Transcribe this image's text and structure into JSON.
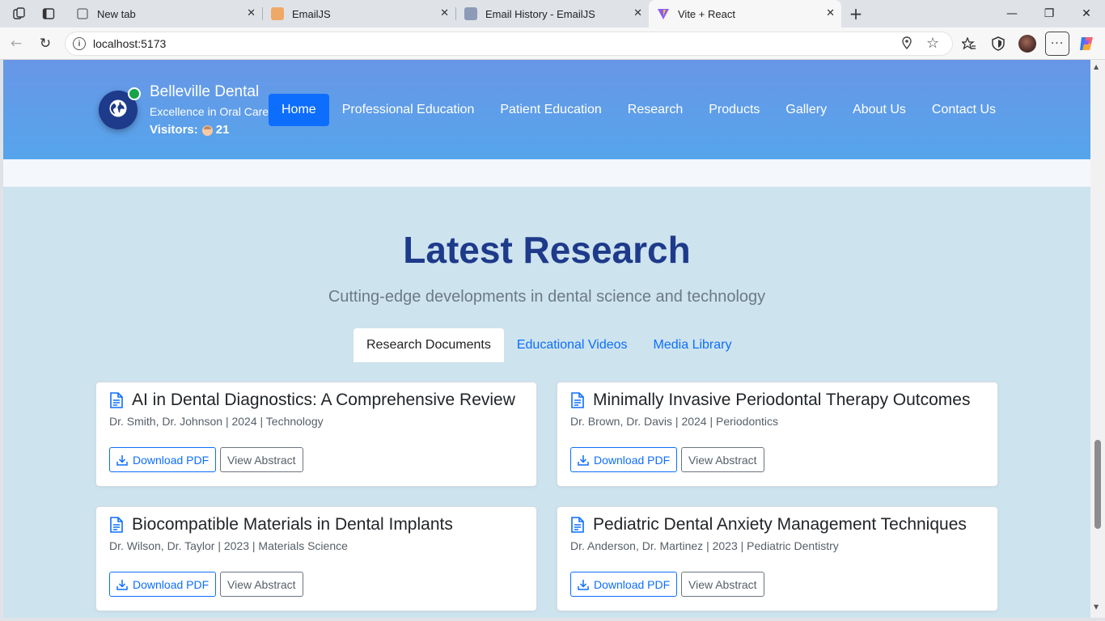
{
  "browser": {
    "tabs": [
      {
        "title": "New tab",
        "icon": "new-tab-icon"
      },
      {
        "title": "EmailJS",
        "icon": "emailjs-icon"
      },
      {
        "title": "Email History - EmailJS",
        "icon": "emailjs-icon"
      },
      {
        "title": "Vite + React",
        "icon": "vite-icon",
        "active": true
      }
    ],
    "url": "localhost:5173"
  },
  "header": {
    "brand_name": "Belleville Dental",
    "tagline": "Excellence in Oral Care",
    "visitors_label": "Visitors:",
    "visitors_count": "21",
    "nav": [
      "Home",
      "Professional Education",
      "Patient Education",
      "Research",
      "Products",
      "Gallery",
      "About Us",
      "Contact Us"
    ],
    "active_nav": "Home"
  },
  "research": {
    "title": "Latest Research",
    "subtitle": "Cutting-edge developments in dental science and technology",
    "tabs": [
      "Research Documents",
      "Educational Videos",
      "Media Library"
    ],
    "active_tab": "Research Documents",
    "download_label": "Download PDF",
    "abstract_label": "View Abstract",
    "documents": [
      {
        "title": "AI in Dental Diagnostics: A Comprehensive Review",
        "meta": "Dr. Smith, Dr. Johnson | 2024 | Technology"
      },
      {
        "title": "Minimally Invasive Periodontal Therapy Outcomes",
        "meta": "Dr. Brown, Dr. Davis | 2024 | Periodontics"
      },
      {
        "title": "Biocompatible Materials in Dental Implants",
        "meta": "Dr. Wilson, Dr. Taylor | 2023 | Materials Science"
      },
      {
        "title": "Pediatric Dental Anxiety Management Techniques",
        "meta": "Dr. Anderson, Dr. Martinez | 2023 | Pediatric Dentistry"
      }
    ]
  },
  "colors": {
    "header_top": "#6896e6",
    "header_bottom": "#56a5ec",
    "primary": "#0d6efd",
    "title_navy": "#1e3a8a",
    "section_bg": "#cde3ee",
    "status_online": "#16a34a"
  }
}
